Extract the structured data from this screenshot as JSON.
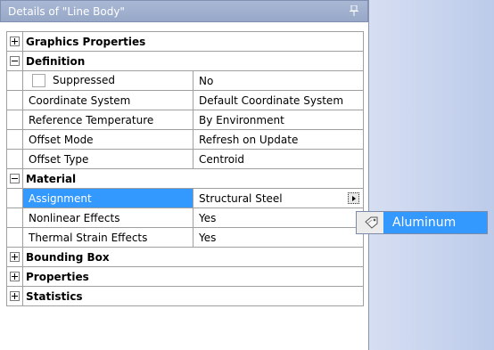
{
  "panel": {
    "title": "Details of \"Line Body\""
  },
  "rows": [
    {
      "type": "category",
      "expander": "plus",
      "label": "Graphics Properties"
    },
    {
      "type": "category",
      "expander": "minus",
      "label": "Definition"
    },
    {
      "type": "property",
      "checkbox": true,
      "label": "Suppressed",
      "value": "No"
    },
    {
      "type": "property",
      "label": "Coordinate System",
      "value": "Default Coordinate System"
    },
    {
      "type": "property",
      "label": "Reference Temperature",
      "value": "By Environment"
    },
    {
      "type": "property",
      "label": "Offset Mode",
      "value": "Refresh on Update"
    },
    {
      "type": "property",
      "label": "Offset Type",
      "value": "Centroid"
    },
    {
      "type": "category",
      "expander": "minus",
      "label": "Material"
    },
    {
      "type": "property",
      "label": "Assignment",
      "value": "Structural Steel",
      "selected": true,
      "dropdown": true
    },
    {
      "type": "property",
      "label": "Nonlinear Effects",
      "value": "Yes"
    },
    {
      "type": "property",
      "label": "Thermal Strain Effects",
      "value": "Yes"
    },
    {
      "type": "category",
      "expander": "plus",
      "label": "Bounding Box"
    },
    {
      "type": "category",
      "expander": "plus",
      "label": "Properties"
    },
    {
      "type": "category",
      "expander": "plus",
      "label": "Statistics"
    }
  ],
  "popup": {
    "item_label": "Aluminum",
    "icon": "material-tag-icon"
  },
  "colors": {
    "selection": "#3399ff",
    "header": "#9aabca",
    "viewport": "#c7d3ee"
  }
}
